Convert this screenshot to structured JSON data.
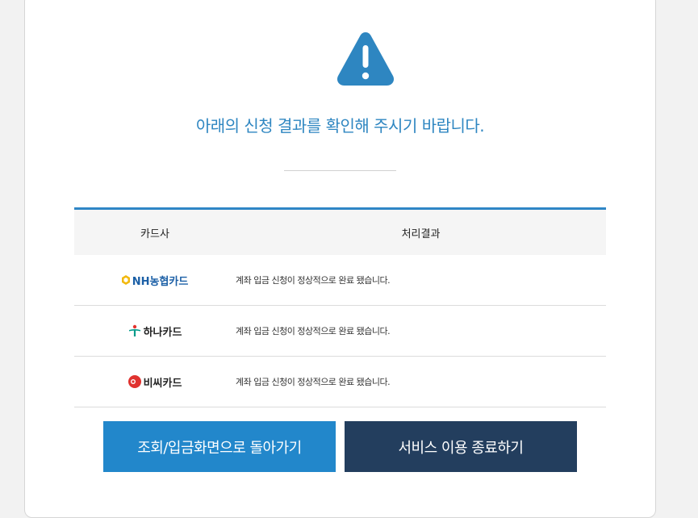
{
  "headline": "아래의 신청 결과를 확인해 주시기 바랍니다.",
  "table": {
    "headers": {
      "card_company": "카드사",
      "result": "처리결과"
    },
    "rows": [
      {
        "card": "NH농협카드",
        "logo_icon": "nh-card-logo-icon",
        "result": "계좌 입금 신청이 정상적으로 완료 됐습니다."
      },
      {
        "card": "하나카드",
        "logo_icon": "hana-card-logo-icon",
        "result": "계좌 입금 신청이 정상적으로 완료 됐습니다."
      },
      {
        "card": "비씨카드",
        "logo_icon": "bc-card-logo-icon",
        "result": "계좌 입금 신청이 정상적으로 완료 됐습니다."
      }
    ]
  },
  "buttons": {
    "back_label": "조회/입금화면으로 돌아가기",
    "end_label": "서비스 이용 종료하기"
  },
  "colors": {
    "accent": "#2e86c1",
    "back_button": "#2287cb",
    "end_button": "#233e5e"
  }
}
